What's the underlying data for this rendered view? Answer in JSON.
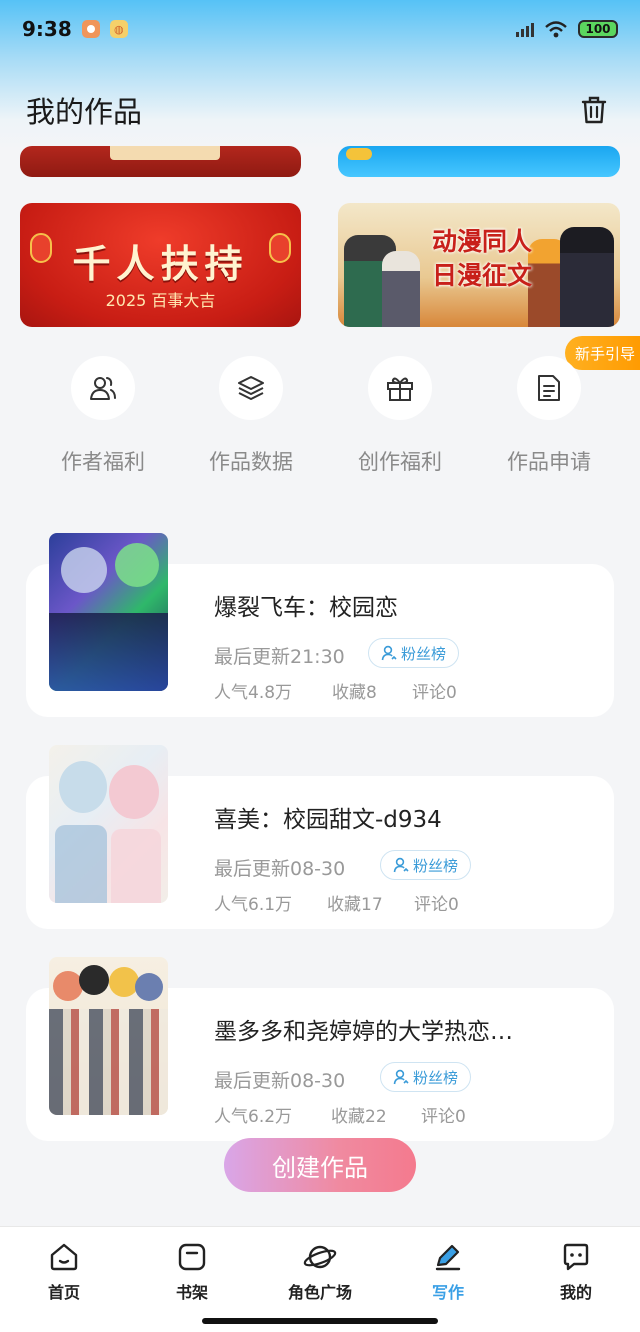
{
  "status_bar": {
    "time": "9:38",
    "battery": "100",
    "app_icons": [
      "record-icon",
      "notification-icon"
    ]
  },
  "header": {
    "title": "我的作品",
    "trash_icon": "trash-icon"
  },
  "banners": {
    "left": {
      "title": "千人扶持",
      "subtitle": "2025 百事大吉"
    },
    "right": {
      "title_line1": "动漫同人",
      "title_line2": "日漫征文"
    }
  },
  "guide_badge": "新手引导",
  "quick_actions": [
    {
      "label": "作者福利",
      "icon": "people-icon"
    },
    {
      "label": "作品数据",
      "icon": "layers-icon"
    },
    {
      "label": "创作福利",
      "icon": "gift-icon"
    },
    {
      "label": "作品申请",
      "icon": "document-icon"
    }
  ],
  "works": [
    {
      "title": "爆裂飞车：校园恋",
      "updated": "最后更新21:30",
      "fan_tag": "粉丝榜",
      "popularity": "人气4.8万",
      "favorites": "收藏8",
      "comments": "评论0"
    },
    {
      "title": "喜美：校园甜文-d934",
      "updated": "最后更新08-30",
      "fan_tag": "粉丝榜",
      "popularity": "人气6.1万",
      "favorites": "收藏17",
      "comments": "评论0"
    },
    {
      "title": "墨多多和尧婷婷的大学热恋…",
      "updated": "最后更新08-30",
      "fan_tag": "粉丝榜",
      "popularity": "人气6.2万",
      "favorites": "收藏22",
      "comments": "评论0"
    }
  ],
  "create_button": "创建作品",
  "tabbar": [
    {
      "label": "首页",
      "icon": "home-icon"
    },
    {
      "label": "书架",
      "icon": "bookshelf-icon"
    },
    {
      "label": "角色广场",
      "icon": "planet-icon"
    },
    {
      "label": "写作",
      "icon": "pen-icon",
      "active": true
    },
    {
      "label": "我的",
      "icon": "chat-icon"
    }
  ],
  "colors": {
    "accent": "#3aa0e6",
    "create_button_start": "#d9a6e8",
    "create_button_end": "#f47a8e",
    "guide_badge": "#ffa412"
  }
}
